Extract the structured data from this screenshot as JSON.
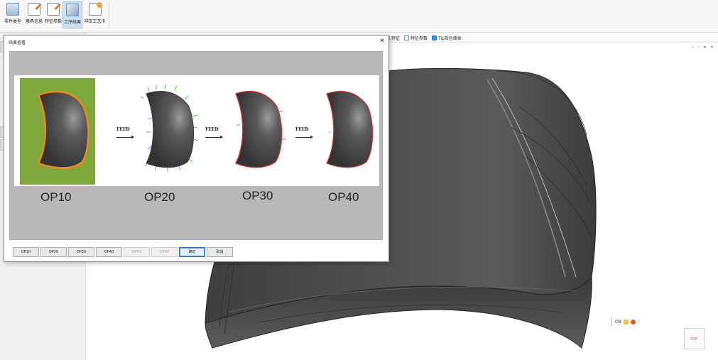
{
  "ribbon": {
    "buttons": [
      {
        "label": "零件类型",
        "icon": "part-type-icon"
      },
      {
        "label": "模具信息",
        "icon": "die-info-icon"
      },
      {
        "label": "特征参数",
        "icon": "feature-params-icon"
      },
      {
        "label": "工序结果",
        "icon": "process-result-icon",
        "active": true
      },
      {
        "label": "冲压工艺卡",
        "icon": "stamping-card-icon"
      }
    ]
  },
  "subbar": {
    "item1": "孔特征",
    "item2": "特征参数",
    "item3": "Tip及包络体"
  },
  "viewport": {
    "controls": "‹ › ▾ ✕"
  },
  "status": {
    "lang": "CN",
    "suffix": "⁝"
  },
  "nav_cube": {
    "label": "TOP"
  },
  "dialog": {
    "title": "结果查看",
    "close": "✕",
    "feed_label": "FEED",
    "operations": [
      "OP10",
      "OP20",
      "OP30",
      "OP40"
    ],
    "buttons": [
      {
        "label": "OP10",
        "enabled": true
      },
      {
        "label": "OP20",
        "enabled": true
      },
      {
        "label": "OP30",
        "enabled": true
      },
      {
        "label": "OP40",
        "enabled": true
      },
      {
        "label": "OP50",
        "enabled": false
      },
      {
        "label": "OP60",
        "enabled": false
      }
    ],
    "ok_label": "确定",
    "cancel_label": "取消"
  },
  "colors": {
    "panel_green": "#7fa83a",
    "part_gray": "#4a4a4a",
    "trim_red": "#d03030",
    "outline_orange": "#f08a20",
    "accent_blue": "#2a6fd0"
  }
}
